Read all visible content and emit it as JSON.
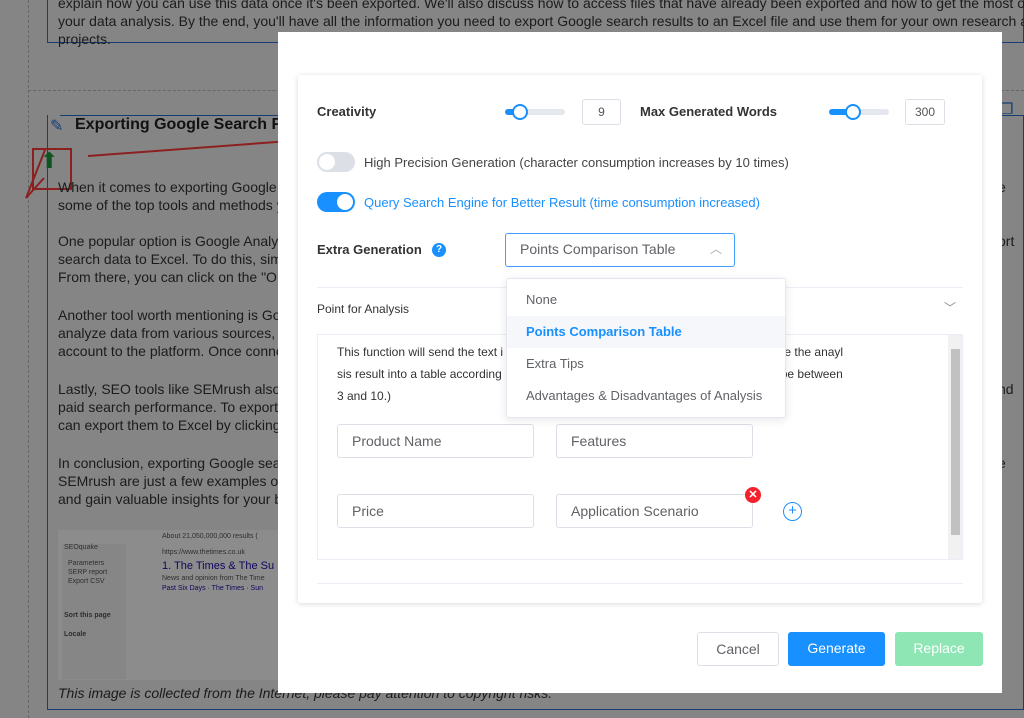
{
  "article": {
    "intro_lines": [
      "explain how you can use this data once it's been exported. We'll also discuss how to access files that have already been exported and how to get the most out of",
      "your data analysis. By the end, you'll have all the information you need to export Google search results to an Excel file and use them for your own research and",
      "projects."
    ],
    "heading": "Exporting Google Search F",
    "paragraphs": [
      [
        "When it comes to exporting Google se",
        "some of the top tools and methods yo"
      ],
      [
        "One popular option is Google Analytic",
        "search data to Excel. To do this, simpl",
        "From there, you can click on the \"Orga"
      ],
      [
        "Another tool worth mentioning is Goog",
        "analyze data from various sources, in",
        "account to the platform. Once connec"
      ],
      [
        "Lastly, SEO tools like SEMrush also o",
        "paid search performance. To export se",
        "can export them to Excel by clicking o"
      ],
      [
        "In conclusion, exporting Google searc",
        "SEMrush are just a few examples of t",
        "and gain valuable insights for your bus"
      ]
    ],
    "right_fragments": [
      "e",
      "ort",
      "nd",
      "e"
    ],
    "image": {
      "seoquake": "SEOquake",
      "menu": [
        "Parameters",
        "SERP report",
        "Export CSV"
      ],
      "sort": "Sort this page",
      "locale": "Locale",
      "results": "About 21,050,000,000 results (",
      "url": "https://www.thetimes.co.uk",
      "title": "1. The Times & The Su",
      "desc": "News and opinion from The Time",
      "links": "Past Six Days · The Times · Sun"
    },
    "caption": "This image is collected from the Internet, please pay attention to copyright risks."
  },
  "modal": {
    "creativity_label": "Creativity",
    "creativity_value": "9",
    "creativity_level": 0.25,
    "max_words_label": "Max Generated Words",
    "max_words_value": "300",
    "max_words_level": 0.4,
    "high_precision_label": "High Precision Generation (character consumption increases by 10 times)",
    "high_precision_on": false,
    "query_search_label": "Query Search Engine for Better Result (time consumption increased)",
    "query_search_on": true,
    "extra_generation_label": "Extra Generation",
    "extra_generation_value": "Points Comparison Table",
    "dropdown_options": [
      "None",
      "Points Comparison Table",
      "Extra Tips",
      "Advantages & Disadvantages of Analysis"
    ],
    "point_section_label": "Point for Analysis",
    "description_lines": [
      "This function will send the text i",
      "e, then organize the anayl",
      "sis result into a table according",
      "oints can only be between",
      "3 and 10.)"
    ],
    "points": [
      "Product Name",
      "Features",
      "Price",
      "Application Scenario"
    ],
    "cancel": "Cancel",
    "generate": "Generate",
    "replace": "Replace"
  },
  "colors": {
    "accent": "#1890ff",
    "replace": "#8ee6b4",
    "danger": "#f5222d",
    "annotation": "#ff3b3b",
    "upload_arrow": "#1a9a3a"
  }
}
